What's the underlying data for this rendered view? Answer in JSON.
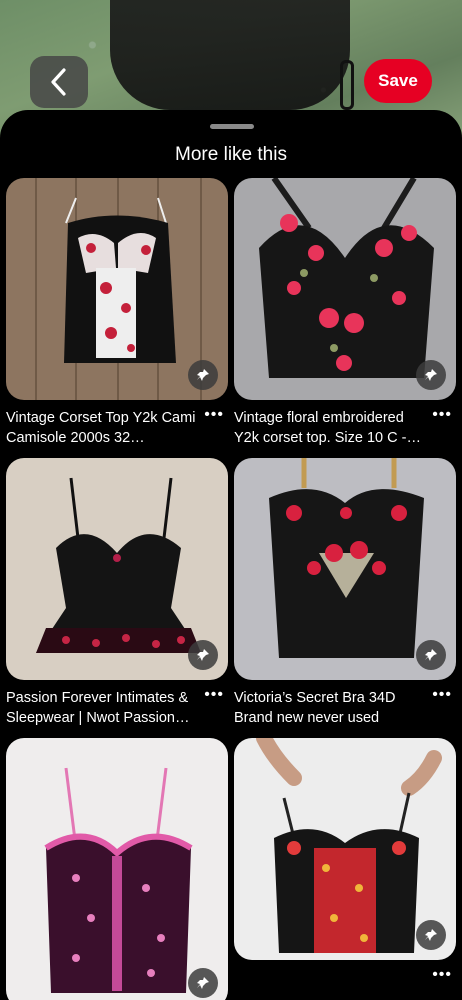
{
  "header": {
    "save_label": "Save"
  },
  "sheet": {
    "title": "More like this"
  },
  "pins": [
    {
      "title": "Vintage Corset Top Y2k Cami Camisole 2000s 32…",
      "more": "•••"
    },
    {
      "title": "Vintage floral embroidered Y2k corset top. Size 10 C -…",
      "more": "•••"
    },
    {
      "title": "Passion Forever Intimates & Sleepwear | Nwot Passion…",
      "more": "•••"
    },
    {
      "title": "Victoria’s Secret Bra 34D Brand new never used",
      "more": "•••"
    },
    {
      "title": "",
      "more": ""
    },
    {
      "title": "",
      "more": "•••"
    }
  ],
  "colors": {
    "accent": "#e60023",
    "background": "#000000"
  },
  "icons": [
    "back-chevron-icon",
    "pin-icon",
    "more-icon"
  ]
}
